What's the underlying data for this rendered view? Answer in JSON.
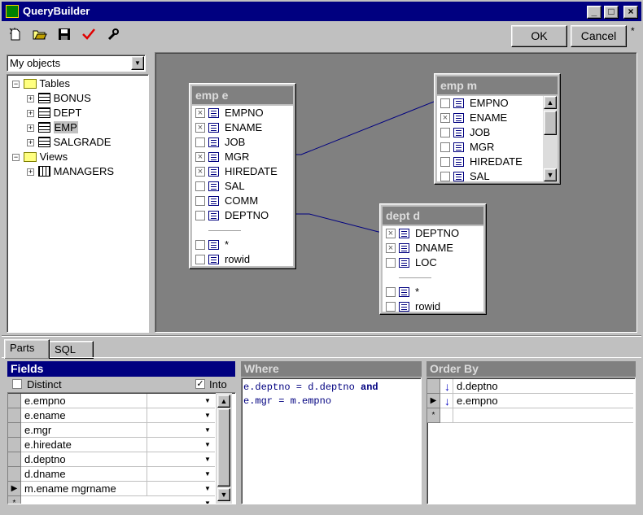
{
  "window": {
    "title": "QueryBuilder",
    "min_label": "_",
    "max_label": "□",
    "close_label": "×"
  },
  "toolbar": {
    "ok_label": "OK",
    "cancel_label": "Cancel",
    "corner_mark": "*"
  },
  "object_combo": {
    "value": "My objects"
  },
  "tree": {
    "tables_label": "Tables",
    "tables": [
      "BONUS",
      "DEPT",
      "EMP",
      "SALGRADE"
    ],
    "views_label": "Views",
    "views": [
      "MANAGERS"
    ]
  },
  "diagram": {
    "emp_e": {
      "title": "emp e",
      "fields": [
        {
          "name": "EMPNO",
          "checked": true
        },
        {
          "name": "ENAME",
          "checked": true
        },
        {
          "name": "JOB",
          "checked": false
        },
        {
          "name": "MGR",
          "checked": true
        },
        {
          "name": "HIREDATE",
          "checked": true
        },
        {
          "name": "SAL",
          "checked": false
        },
        {
          "name": "COMM",
          "checked": false
        },
        {
          "name": "DEPTNO",
          "checked": false
        }
      ],
      "star": "*",
      "rowid": "rowid"
    },
    "emp_m": {
      "title": "emp m",
      "fields": [
        {
          "name": "EMPNO",
          "checked": false
        },
        {
          "name": "ENAME",
          "checked": true
        },
        {
          "name": "JOB",
          "checked": false
        },
        {
          "name": "MGR",
          "checked": false
        },
        {
          "name": "HIREDATE",
          "checked": false
        },
        {
          "name": "SAL",
          "checked": false
        }
      ]
    },
    "dept_d": {
      "title": "dept d",
      "fields": [
        {
          "name": "DEPTNO",
          "checked": true
        },
        {
          "name": "DNAME",
          "checked": true
        },
        {
          "name": "LOC",
          "checked": false
        }
      ],
      "star": "*",
      "rowid": "rowid"
    }
  },
  "tabs": {
    "parts": "Parts",
    "sql": "SQL"
  },
  "fields_panel": {
    "title": "Fields",
    "distinct_label": "Distinct",
    "distinct_checked": false,
    "into_label": "Into",
    "into_checked": true,
    "rows": [
      "e.empno",
      "e.ename",
      "e.mgr",
      "e.hiredate",
      "d.deptno",
      "d.dname",
      "m.ename mgrname"
    ],
    "new_row_marker": "*"
  },
  "where_panel": {
    "title": "Where",
    "line1_a": "e.deptno = d.deptno ",
    "line1_kw": "and",
    "line2": "e.mgr = m.empno"
  },
  "orderby_panel": {
    "title": "Order By",
    "rows": [
      "d.deptno",
      "e.empno"
    ],
    "new_row_marker": "*"
  },
  "colors": {
    "title_active": "#000080",
    "link_line": "#000080",
    "canvas": "#808080",
    "table_header_inactive": "#808080"
  }
}
